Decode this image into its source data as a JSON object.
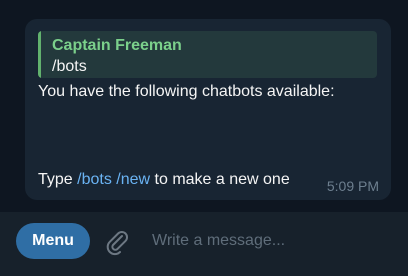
{
  "message": {
    "reply": {
      "author": "Captain Freeman",
      "text": "/bots"
    },
    "line1": "You have the following chatbots available:",
    "line2_prefix": "Type ",
    "line2_link1": "/bots",
    "line2_link2": "/new",
    "line2_suffix": " to make a new one",
    "time": "5:09 PM"
  },
  "composer": {
    "menu_label": "Menu",
    "attach_icon": "paperclip-icon",
    "placeholder": "Write a message..."
  },
  "colors": {
    "background": "#0e1621",
    "bubble": "#182533",
    "reply_accent": "#62b26e",
    "reply_author": "#7bd08b",
    "link": "#6ab3f3",
    "menu_button": "#2f6ea5",
    "composer": "#17212b"
  }
}
